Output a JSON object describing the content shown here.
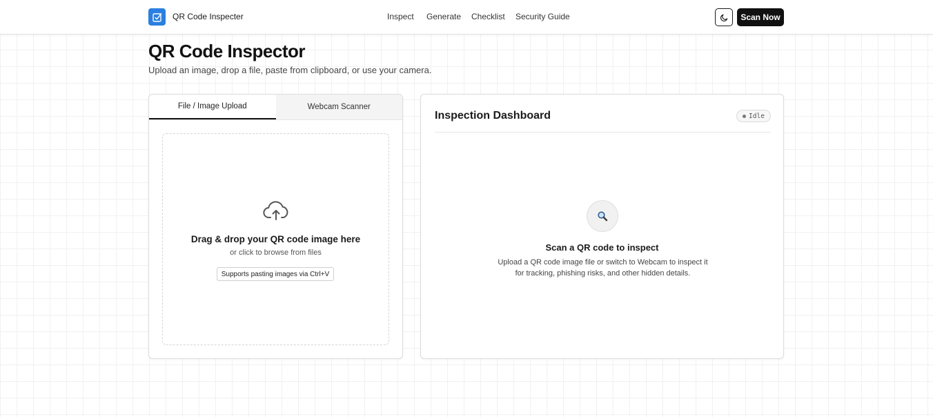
{
  "header": {
    "brand": "QR Code Inspecter",
    "nav": [
      "Inspect",
      "Generate",
      "Checklist",
      "Security Guide"
    ],
    "scan_button": "Scan Now",
    "theme_icon": "moon-icon",
    "logo_icon": "checkbox-icon",
    "accent_color": "#2b7fe0"
  },
  "page": {
    "title": "QR Code Inspector",
    "subtitle": "Upload an image, drop a file, paste from clipboard, or use your camera."
  },
  "upload_panel": {
    "tabs": [
      "File / Image Upload",
      "Webcam Scanner"
    ],
    "active_tab": "File / Image Upload",
    "dropzone_icon": "cloud-upload-icon",
    "dropzone_title": "Drag & drop your QR code image here",
    "dropzone_subtitle": "or click to browse from files",
    "paste_hint": "Supports pasting images via Ctrl+V"
  },
  "dashboard": {
    "title": "Inspection Dashboard",
    "status": "Idle",
    "empty_icon": "magnifier-icon",
    "empty_title": "Scan a QR code to inspect",
    "empty_text": "Upload a QR code image file or switch to Webcam to inspect it for tracking, phishing risks, and other hidden details."
  }
}
